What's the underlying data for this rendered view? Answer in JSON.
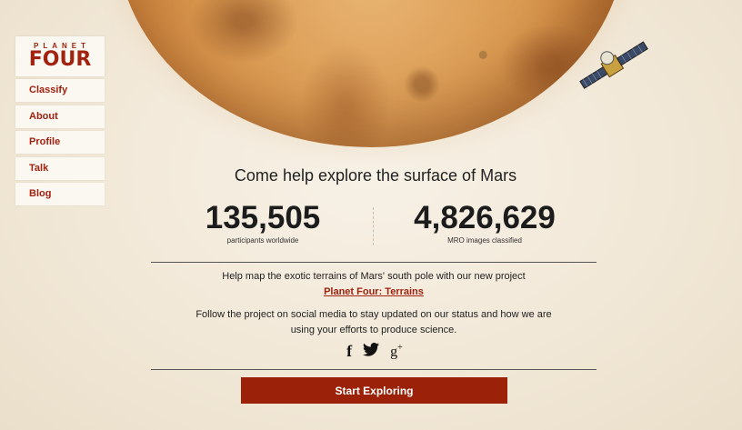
{
  "logo": {
    "line1": "PLANET",
    "line2": "FOUR"
  },
  "nav": {
    "items": [
      {
        "label": "Classify"
      },
      {
        "label": "About"
      },
      {
        "label": "Profile"
      },
      {
        "label": "Talk"
      },
      {
        "label": "Blog"
      }
    ]
  },
  "hero": {
    "headline": "Come help explore the surface of Mars"
  },
  "stats": [
    {
      "value": "135,505",
      "label": "participants worldwide"
    },
    {
      "value": "4,826,629",
      "label": "MRO images classified"
    }
  ],
  "promo": {
    "text": "Help map the exotic terrains of Mars' south pole with our new project",
    "link": "Planet Four: Terrains"
  },
  "social": {
    "text": "Follow the project on social media to stay updated on our status and how we are using your efforts to produce science.",
    "icons": [
      "facebook-icon",
      "twitter-icon",
      "google-plus-icon"
    ]
  },
  "cta": {
    "label": "Start Exploring"
  },
  "colors": {
    "accent": "#9b2108",
    "background": "#f3ebdc"
  }
}
